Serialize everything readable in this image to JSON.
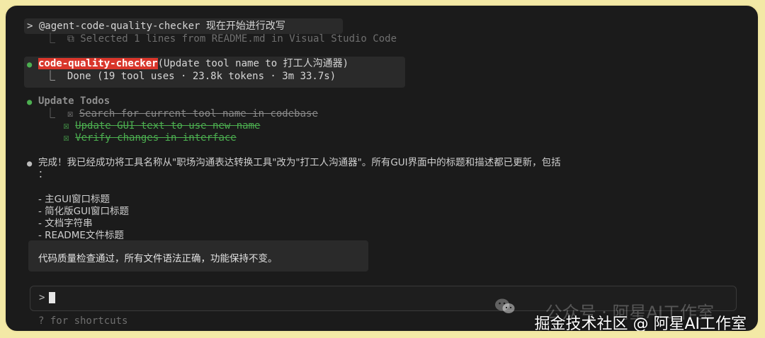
{
  "prompt": {
    "prefix": "> ",
    "command": "@agent-code-quality-checker 现在开始进行改写",
    "selection_note": "⎿  ⧉ Selected 1 lines from README.md in Visual Studio Code"
  },
  "agent_run": {
    "name": "code-quality-checker",
    "args": "(Update tool name to 打工人沟通器)",
    "status": "⎿  Done (19 tool uses · 23.8k tokens · 3m 33.7s)"
  },
  "todos": {
    "title": "Update Todos",
    "items": [
      {
        "prefix": "⎿  ☒ ",
        "text": "Search for current tool name in codebase",
        "state": "done-gray"
      },
      {
        "prefix": "   ☒ ",
        "text": "Update GUI text to use new name",
        "state": "done-green"
      },
      {
        "prefix": "   ☒ ",
        "text": "Verify changes in interface",
        "state": "done-green"
      }
    ]
  },
  "summary": {
    "line1": "完成！我已经成功将工具名称从\"职场沟通表达转换工具\"改为\"打工人沟通器\"。所有GUI界面中的标题和描述都已更新，包括",
    "line2": "：",
    "bullets": [
      "- 主GUI窗口标题",
      "- 简化版GUI窗口标题",
      "- 文档字符串",
      "- README文件标题"
    ],
    "final": "代码质量检查通过，所有文件语法正确，功能保持不变。"
  },
  "input": {
    "prompt_char": ">"
  },
  "footer": {
    "shortcuts": "? for shortcuts"
  },
  "watermark": {
    "top": "公众号 · 阿星AI工作室",
    "bottom": "掘金技术社区 @ 阿星AI工作室"
  },
  "colors": {
    "accent_red": "#d9362b",
    "green": "#4caf50",
    "bullet_green": "#4caf50",
    "bullet_gray": "#bdbdbd"
  }
}
